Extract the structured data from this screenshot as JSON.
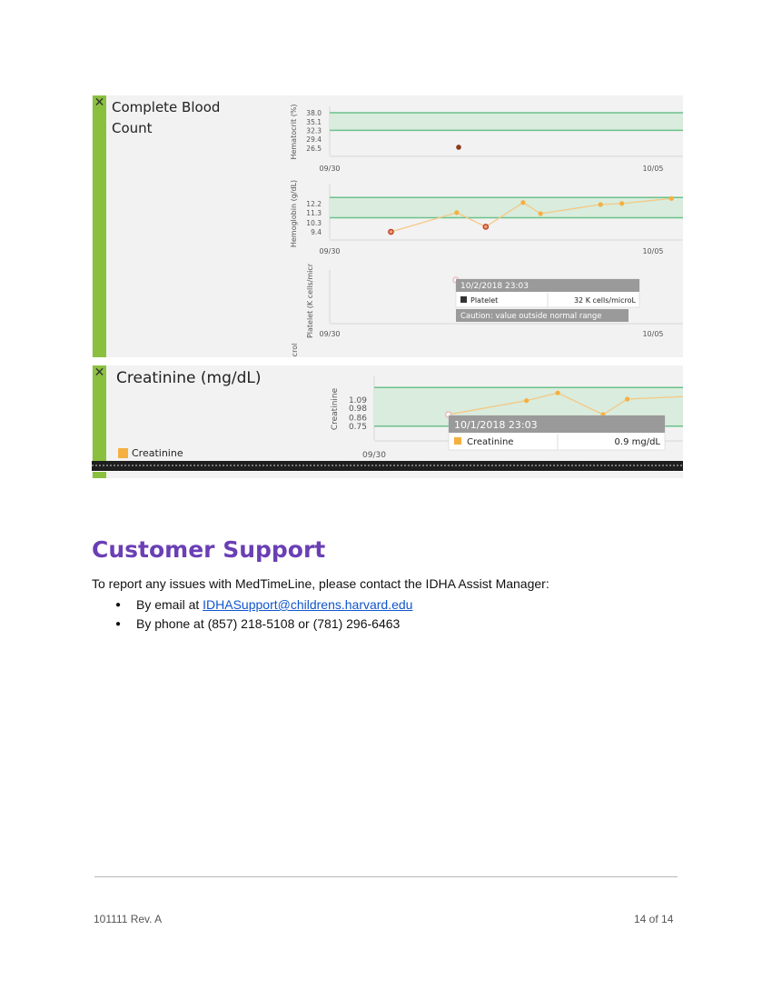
{
  "panels": {
    "cbc": {
      "close_icon": "✕",
      "title": "Complete Blood Count",
      "tooltip": {
        "time": "10/2/2018 23:03",
        "label": "Platelet",
        "value": "32 K cells/microL",
        "caution": "Caution: value outside normal range"
      },
      "cut_off_label": "crol"
    },
    "creatinine": {
      "close_icon": "✕",
      "title": "Creatinine (mg/dL)",
      "legend_label": "Creatinine",
      "tooltip": {
        "time": "10/1/2018 23:03",
        "label": "Creatinine",
        "value": "0.9 mg/dL"
      }
    }
  },
  "chart_data": [
    {
      "type": "scatter",
      "ylabel": "Hematocrit (%)",
      "y_ticks": [
        "38.0",
        "35.1",
        "32.3",
        "29.4",
        "26.5"
      ],
      "x_ticks": [
        "09/30",
        "10/05"
      ],
      "normal_range": [
        32.3,
        38.0
      ],
      "points": [
        {
          "x": "10/02",
          "y": 26.8,
          "abnormal": true
        }
      ]
    },
    {
      "type": "line",
      "ylabel": "Hemoglobin (g/dL)",
      "y_ticks": [
        "12.2",
        "11.3",
        "10.3",
        "9.4"
      ],
      "x_ticks": [
        "09/30",
        "10/05"
      ],
      "normal_range": [
        10.8,
        12.8
      ],
      "points": [
        {
          "x": "10/01",
          "y": 9.4,
          "abnormal": true
        },
        {
          "x": "10/02",
          "y": 11.3,
          "abnormal": false
        },
        {
          "x": "10/03",
          "y": 9.9,
          "abnormal": true
        },
        {
          "x": "10/04",
          "y": 12.3,
          "abnormal": false
        },
        {
          "x": "10/04",
          "y": 11.2,
          "abnormal": false
        },
        {
          "x": "10/05",
          "y": 12.1,
          "abnormal": false
        },
        {
          "x": "10/06",
          "y": 12.2,
          "abnormal": false
        },
        {
          "x": "10/07",
          "y": 12.7,
          "abnormal": false
        }
      ]
    },
    {
      "type": "scatter",
      "ylabel": "Platelet (K cells/micr",
      "x_ticks": [
        "09/30",
        "10/05"
      ],
      "points": [
        {
          "x": "10/02",
          "y": 32,
          "abnormal": true
        }
      ]
    },
    {
      "type": "line",
      "ylabel": "Creatinine",
      "y_ticks": [
        "1.09",
        "0.98",
        "0.86",
        "0.75"
      ],
      "x_ticks": [
        "09/30"
      ],
      "normal_range": [
        0.75,
        1.25
      ],
      "series": [
        {
          "name": "Creatinine",
          "color": "#f5b041"
        }
      ],
      "points": [
        {
          "x": "10/01",
          "y": 0.9,
          "highlighted": true
        },
        {
          "x": "10/02",
          "y": 1.08
        },
        {
          "x": "10/03",
          "y": 1.18
        },
        {
          "x": "10/04",
          "y": 0.9
        },
        {
          "x": "10/05",
          "y": 1.1
        },
        {
          "x": "10/06",
          "y": 1.18
        }
      ]
    }
  ],
  "colors": {
    "panel_accent": "#8bc03f",
    "section_heading": "#6a3fb5",
    "line_series": "#f5b041",
    "abnormal_point": "#c0392b",
    "normal_band": "#d9ecdd",
    "normal_band_border": "#6cc08b",
    "link": "#1155cc"
  },
  "support": {
    "heading": "Customer Support",
    "intro": "To report any issues with MedTimeLine, please contact the IDHA Assist Manager:",
    "email_prefix": "By email at ",
    "email_link": "IDHASupport@childrens.harvard.edu",
    "phone": "By phone at (857) 218-5108 or (781) 296-6463"
  },
  "footer": {
    "doc_id": "101111 Rev. A",
    "page": "14 of 14"
  }
}
